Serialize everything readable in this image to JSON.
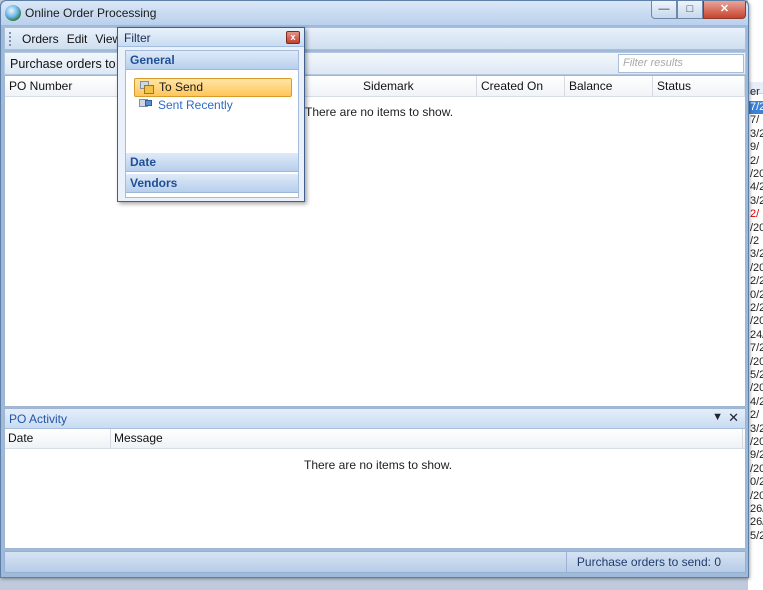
{
  "window": {
    "title": "Online Order Processing"
  },
  "menu": {
    "items": [
      "Orders",
      "Edit",
      "View"
    ]
  },
  "subbar": {
    "caption": "Purchase orders to",
    "search_placeholder": "Filter results"
  },
  "grid": {
    "columns": [
      "PO Number",
      "Sidemark",
      "Created On",
      "Balance",
      "Status"
    ],
    "empty_message": "There are no items to show."
  },
  "filter": {
    "title": "Filter",
    "groups": [
      "General",
      "Date",
      "Vendors"
    ],
    "general_items": [
      "To Send",
      "Sent Recently"
    ],
    "selected_item": "To Send"
  },
  "activity": {
    "title": "PO Activity",
    "columns": [
      "Date",
      "Message"
    ],
    "empty_message": "There are no items to show.",
    "pin_icon": "pin-icon",
    "close_icon": "close-icon"
  },
  "status": {
    "text": "Purchase orders to send: 0"
  },
  "background_window": {
    "header_text": "er [",
    "rows": [
      "7/2",
      "7/",
      "3/2",
      "9/",
      "2/",
      "/20",
      "4/2",
      "3/2",
      "2/",
      "/20",
      "/2",
      "3/2",
      "/20",
      "2/2",
      "0/2",
      "2/2",
      "/20",
      "24/",
      "7/2",
      "/20",
      "5/2",
      "/20",
      "4/2",
      "2/",
      "3/2",
      "/20",
      "9/2",
      "/20",
      "0/2",
      "/20",
      "26/",
      "26/",
      "5/2"
    ],
    "selected_row_index": 0,
    "red_row_index": 8
  },
  "colors": {
    "accent": "#2456a4",
    "selection": "#ffc55a",
    "close": "#c7442f"
  }
}
